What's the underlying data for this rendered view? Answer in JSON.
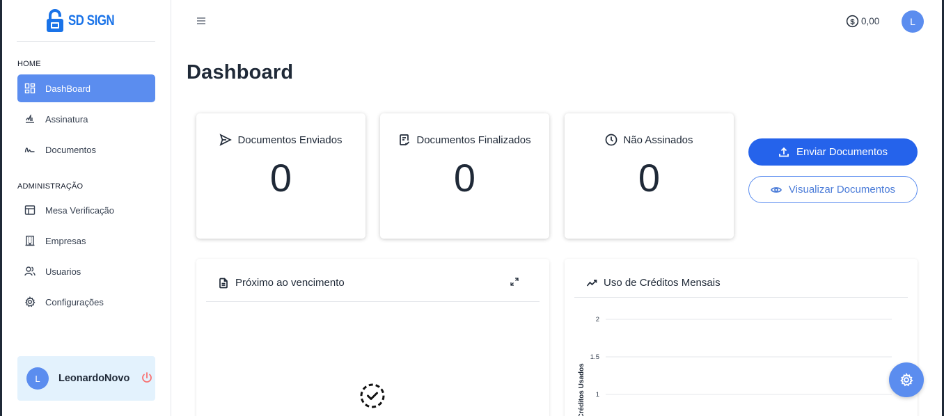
{
  "brand": {
    "logo_text": "SD SIGN",
    "color": "#1a73e8"
  },
  "sidebar": {
    "sections": [
      {
        "label": "HOME"
      },
      {
        "label": "ADMINISTRAÇÃO"
      }
    ],
    "items": [
      {
        "label": "DashBoard",
        "icon": "dashboard-icon",
        "active": true
      },
      {
        "label": "Assinatura",
        "icon": "signature-icon"
      },
      {
        "label": "Documentos",
        "icon": "documents-icon"
      },
      {
        "label": "Mesa Verificação",
        "icon": "table-icon"
      },
      {
        "label": "Empresas",
        "icon": "building-icon"
      },
      {
        "label": "Usuarios",
        "icon": "users-icon"
      },
      {
        "label": "Configurações",
        "icon": "gear-icon"
      }
    ],
    "user": {
      "initial": "L",
      "name": "LeonardoNovo"
    }
  },
  "topbar": {
    "balance": "0,00",
    "avatar_initial": "L"
  },
  "page": {
    "title": "Dashboard"
  },
  "stats": [
    {
      "label": "Documentos Enviados",
      "value": "0",
      "icon": "send-icon"
    },
    {
      "label": "Documentos Finalizados",
      "value": "0",
      "icon": "document-check-icon"
    },
    {
      "label": "Não Assinados",
      "value": "0",
      "icon": "clock-icon"
    }
  ],
  "actions": {
    "send_label": "Enviar Documentos",
    "view_label": "Visualizar Documentos"
  },
  "panels": {
    "due": {
      "title": "Próximo ao vencimento"
    },
    "credits": {
      "title": "Uso de Créditos Mensais"
    }
  },
  "chart_data": {
    "type": "line",
    "title": "Uso de Créditos Mensais",
    "ylabel": "Créditos Usados",
    "yticks": [
      "2",
      "1.5",
      "1"
    ],
    "series": []
  },
  "colors": {
    "accent": "#5b8def",
    "primary_button": "#2563eb",
    "user_box_bg": "#e3f2fd",
    "power_icon": "#f87171"
  }
}
